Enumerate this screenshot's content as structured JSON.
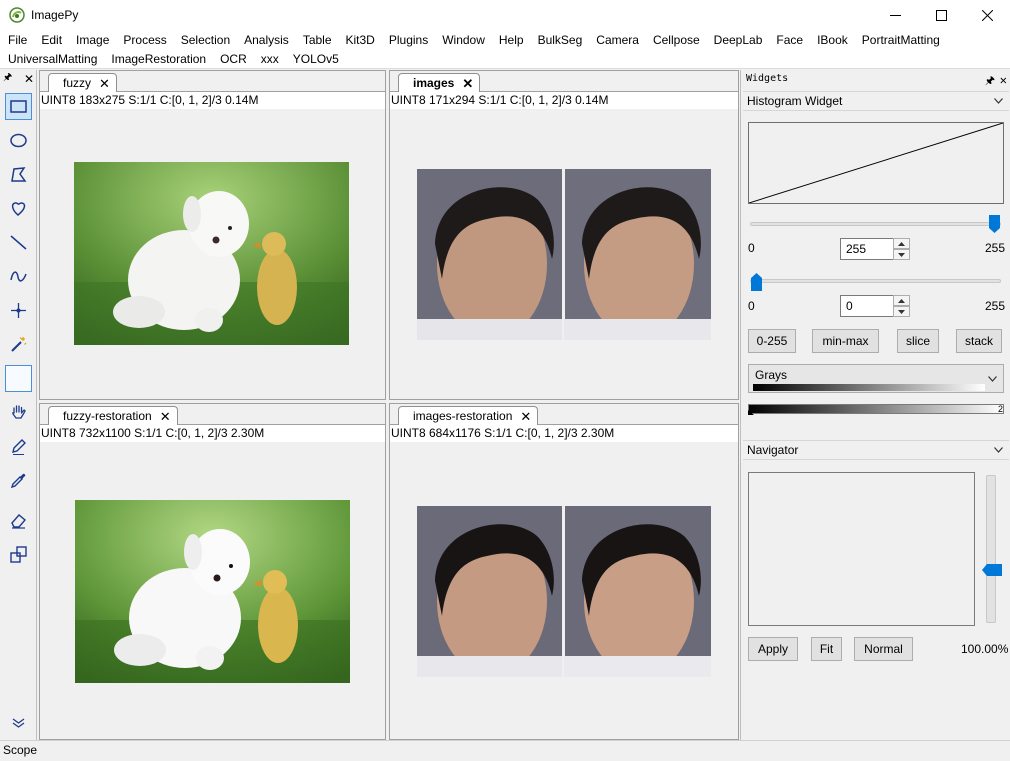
{
  "window": {
    "title": "ImagePy"
  },
  "menus": {
    "row1": [
      "File",
      "Edit",
      "Image",
      "Process",
      "Selection",
      "Analysis",
      "Table",
      "Kit3D",
      "Plugins",
      "Window",
      "Help",
      "BulkSeg",
      "Camera",
      "Cellpose",
      "DeepLab",
      "Face",
      "IBook",
      "PortraitMatting"
    ],
    "row2": [
      "UniversalMatting",
      "ImageRestoration",
      "OCR",
      "xxx",
      "YOLOv5"
    ]
  },
  "tools": [
    "rectangle-select",
    "ellipse-select",
    "polygon-select",
    "freehand-select",
    "line",
    "freeline",
    "point",
    "magic-wand",
    "empty-slot",
    "hand",
    "pencil",
    "color-picker",
    "eraser",
    "transform",
    "more"
  ],
  "panes": [
    {
      "tab": "fuzzy",
      "active": false,
      "info": "UINT8  183x275  S:1/1  C:[0, 1, 2]/3  0.14M"
    },
    {
      "tab": "images",
      "active": true,
      "info": "UINT8  171x294  S:1/1  C:[0, 1, 2]/3  0.14M"
    },
    {
      "tab": "fuzzy-restoration",
      "active": false,
      "info": "UINT8  732x1100  S:1/1  C:[0, 1, 2]/3  2.30M"
    },
    {
      "tab": "images-restoration",
      "active": false,
      "info": "UINT8  684x1176  S:1/1  C:[0, 1, 2]/3  2.30M"
    }
  ],
  "widgets": {
    "title": "Widgets",
    "histogram": {
      "title": "Histogram Widget",
      "high": {
        "min": "0",
        "value": "255",
        "max": "255"
      },
      "low": {
        "min": "0",
        "value": "0",
        "max": "255"
      },
      "buttons": [
        "0-255",
        "min-max",
        "slice",
        "stack"
      ],
      "colormap": "Grays",
      "gradbar_marker": "2"
    },
    "navigator": {
      "title": "Navigator",
      "buttons": [
        "Apply",
        "Fit",
        "Normal"
      ],
      "zoom": "100.00%"
    }
  },
  "status": "Scope",
  "colors": {
    "accent": "#0078d7",
    "tool_selected": "#cde3f7"
  }
}
